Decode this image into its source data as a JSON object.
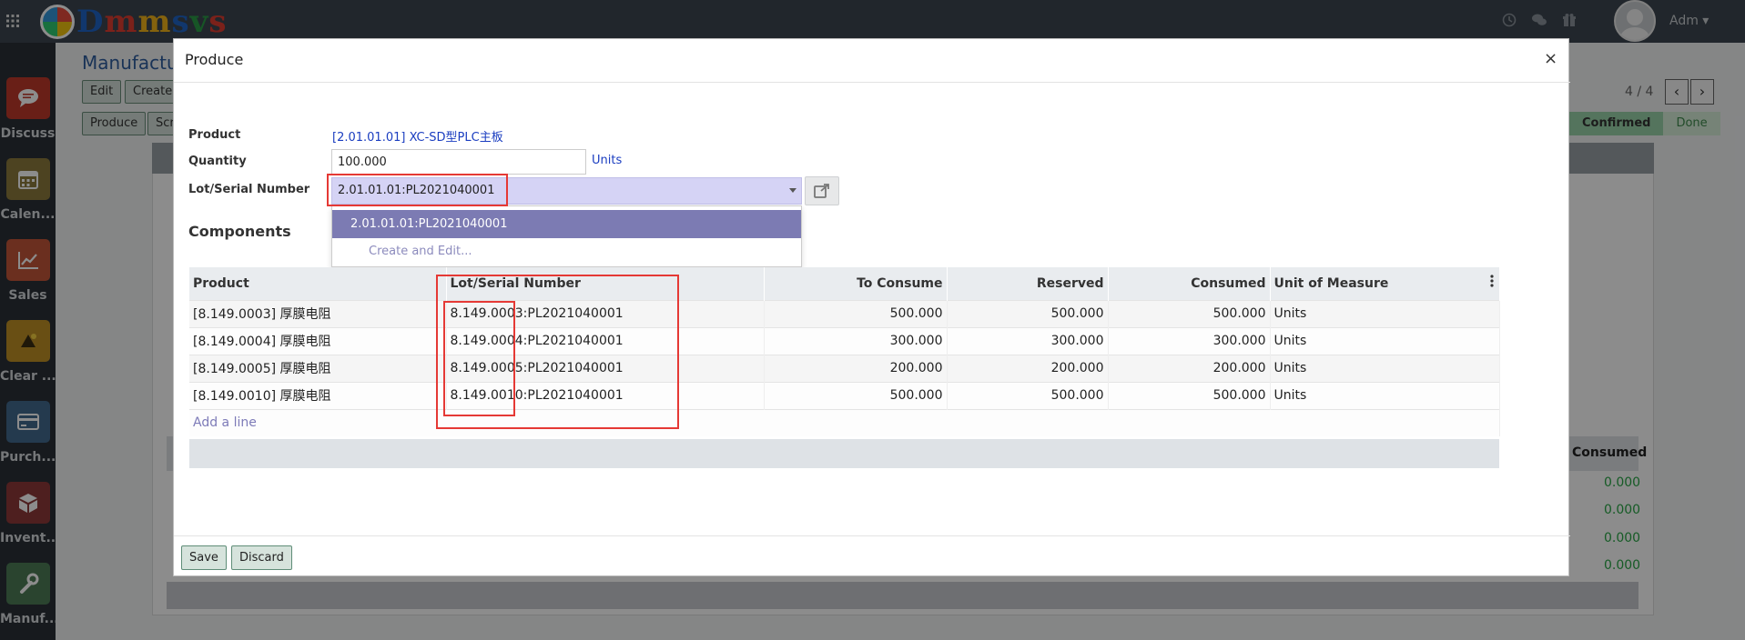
{
  "topbar": {
    "logo_text": [
      "D",
      "m",
      "m",
      "s",
      "v",
      "s"
    ],
    "user_name": "Adm ▾",
    "icons": [
      "clock-icon",
      "chat-icon",
      "gift-icon"
    ]
  },
  "sidebar": {
    "items": [
      {
        "label": "Discuss",
        "color": "#c0392b",
        "icon": "💬"
      },
      {
        "label": "Calen...",
        "color": "#8c7a3d",
        "icon": "📅"
      },
      {
        "label": "Sales",
        "color": "#c4573a",
        "icon": "📈"
      },
      {
        "label": "Clear ...",
        "color": "#c09126",
        "icon": "🪣"
      },
      {
        "label": "Purch...",
        "color": "#436b8f",
        "icon": "💳"
      },
      {
        "label": "Invent...",
        "color": "#8e3a3a",
        "icon": "📦"
      },
      {
        "label": "Manuf...",
        "color": "#4e7d57",
        "icon": "🔧"
      }
    ]
  },
  "background": {
    "title": "Manufacturi",
    "edit_label": "Edit",
    "create_label": "Create",
    "produce_label": "Produce",
    "scrap_label": "Scr",
    "pager": "4 / 4",
    "prev_label": "‹",
    "next_label": "›",
    "stage_confirmed": "Confirmed",
    "stage_done": "Done",
    "consumed_header": "Consumed",
    "consumed_values": [
      "0.000",
      "0.000",
      "0.000",
      "0.000"
    ]
  },
  "modal": {
    "title": "Produce",
    "close_label": "×",
    "product_label": "Product",
    "product_value": "[2.01.01.01] XC-SD型PLC主板",
    "quantity_label": "Quantity",
    "quantity_value": "100.000",
    "quantity_unit": "Units",
    "lot_label": "Lot/Serial Number",
    "lot_value": "2.01.01.01:PL2021040001",
    "dropdown": {
      "selected": "2.01.01.01:PL2021040001",
      "create_edit": "Create and Edit..."
    },
    "components_title": "Components",
    "table": {
      "headers": [
        "Product",
        "Lot/Serial Number",
        "To Consume",
        "Reserved",
        "Consumed",
        "Unit of Measure"
      ],
      "rows": [
        {
          "product": "[8.149.0003] 厚膜电阻",
          "lot": "8.149.0003:PL2021040001",
          "to_consume": "500.000",
          "reserved": "500.000",
          "consumed": "500.000",
          "uom": "Units"
        },
        {
          "product": "[8.149.0004] 厚膜电阻",
          "lot": "8.149.0004:PL2021040001",
          "to_consume": "300.000",
          "reserved": "300.000",
          "consumed": "300.000",
          "uom": "Units"
        },
        {
          "product": "[8.149.0005] 厚膜电阻",
          "lot": "8.149.0005:PL2021040001",
          "to_consume": "200.000",
          "reserved": "200.000",
          "consumed": "200.000",
          "uom": "Units"
        },
        {
          "product": "[8.149.0010] 厚膜电阻",
          "lot": "8.149.0010:PL2021040001",
          "to_consume": "500.000",
          "reserved": "500.000",
          "consumed": "500.000",
          "uom": "Units"
        }
      ],
      "add_line": "Add a line"
    },
    "save_label": "Save",
    "discard_label": "Discard"
  },
  "colors": {
    "annotation_red": "#e53935",
    "dropdown_selected": "#7c7bb3",
    "link_blue": "#1a3dc0"
  }
}
